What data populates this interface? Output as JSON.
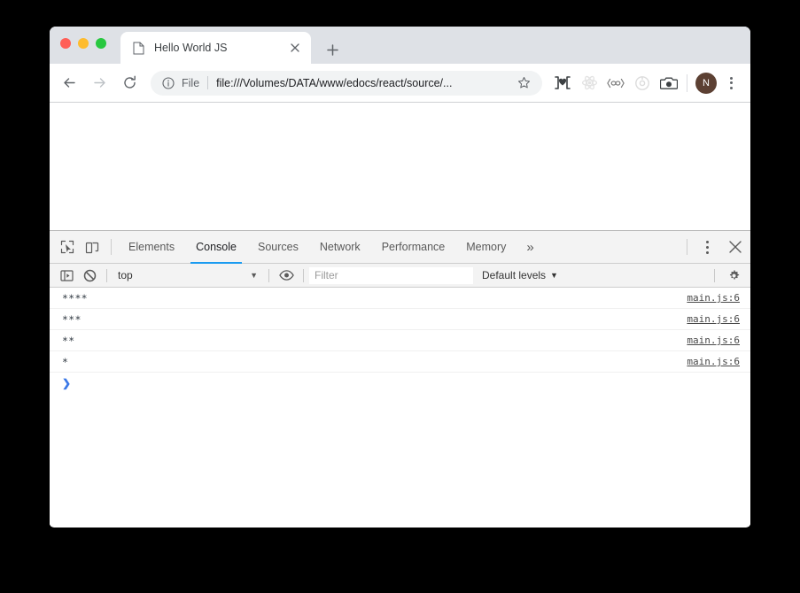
{
  "window": {
    "traffic_lights": [
      {
        "name": "close",
        "color": "#ff5f57"
      },
      {
        "name": "minimize",
        "color": "#febc2e"
      },
      {
        "name": "zoom",
        "color": "#28c840"
      }
    ]
  },
  "tabstrip": {
    "active_tab_title": "Hello World JS",
    "close_label": "×",
    "new_tab_label": "+"
  },
  "toolbar": {
    "back_label": "←",
    "forward_label": "→",
    "reload_label": "↻",
    "scheme_label": "File",
    "url": "file:///Volumes/DATA/www/edocs/react/source/...",
    "bookmark_label": "☆",
    "extensions": [
      {
        "name": "bracket-heart-extension-icon",
        "glyph": "]♥["
      },
      {
        "name": "react-extension-icon",
        "glyph": "⚛"
      },
      {
        "name": "link-extension-icon",
        "glyph": "〈∞〉"
      },
      {
        "name": "target-extension-icon",
        "glyph": "◎"
      },
      {
        "name": "camera-extension-icon",
        "glyph": "▣"
      }
    ],
    "avatar_initial": "N"
  },
  "devtools": {
    "tabs": [
      {
        "label": "Elements",
        "active": false
      },
      {
        "label": "Console",
        "active": true
      },
      {
        "label": "Sources",
        "active": false
      },
      {
        "label": "Network",
        "active": false
      },
      {
        "label": "Performance",
        "active": false
      },
      {
        "label": "Memory",
        "active": false
      }
    ],
    "more_tabs_label": "»",
    "close_label": "✕",
    "accent_color": "#1a9bf0"
  },
  "console": {
    "context": "top",
    "context_caret": "▼",
    "filter_placeholder": "Filter",
    "filter_value": "",
    "levels": "Default levels",
    "levels_caret": "▼",
    "prompt_caret": "❯",
    "messages": [
      {
        "text": "****",
        "source": "main.js:6"
      },
      {
        "text": "***",
        "source": "main.js:6"
      },
      {
        "text": "**",
        "source": "main.js:6"
      },
      {
        "text": "*",
        "source": "main.js:6"
      }
    ]
  }
}
